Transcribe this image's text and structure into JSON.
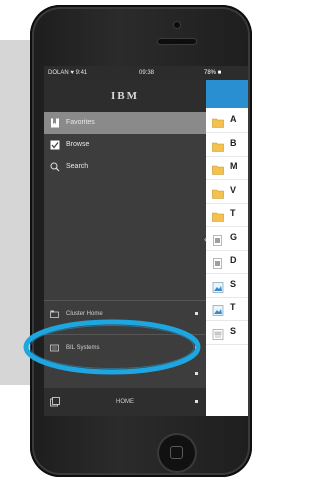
{
  "status_bar": {
    "carrier": "DOLAN ♥ 9:41",
    "time": "09:38",
    "battery": "78% ■"
  },
  "logo": "IBM",
  "menu": [
    {
      "label": "Favorites",
      "icon": "bookmark-icon",
      "selected": true
    },
    {
      "label": "Browse",
      "icon": "checkbox-icon",
      "selected": false
    },
    {
      "label": "Search",
      "icon": "search-icon",
      "selected": false
    }
  ],
  "clusters": [
    {
      "label": "Cluster Home",
      "icon": "home-icon"
    },
    {
      "label": "BIL Systems",
      "icon": "cluster-icon"
    },
    {
      "label": "",
      "icon": "folder-icon"
    }
  ],
  "bottom_bar": {
    "label": "HOME",
    "icon": "gallery-icon"
  },
  "files": [
    {
      "letter": "A",
      "icon": "folder-icon"
    },
    {
      "letter": "B",
      "icon": "folder-icon"
    },
    {
      "letter": "M",
      "icon": "folder-icon"
    },
    {
      "letter": "V",
      "icon": "folder-icon"
    },
    {
      "letter": "T",
      "icon": "folder-icon"
    },
    {
      "letter": "G",
      "icon": "document-icon"
    },
    {
      "letter": "D",
      "icon": "document-icon"
    },
    {
      "letter": "S",
      "icon": "image-icon"
    },
    {
      "letter": "T",
      "icon": "image-icon"
    },
    {
      "letter": "S",
      "icon": "presentation-icon"
    }
  ],
  "colors": {
    "highlight": "#1ea6e0",
    "header_blue": "#2a8fd0",
    "selected_row": "#8a8a8a",
    "drawer": "#3d3d3d"
  }
}
